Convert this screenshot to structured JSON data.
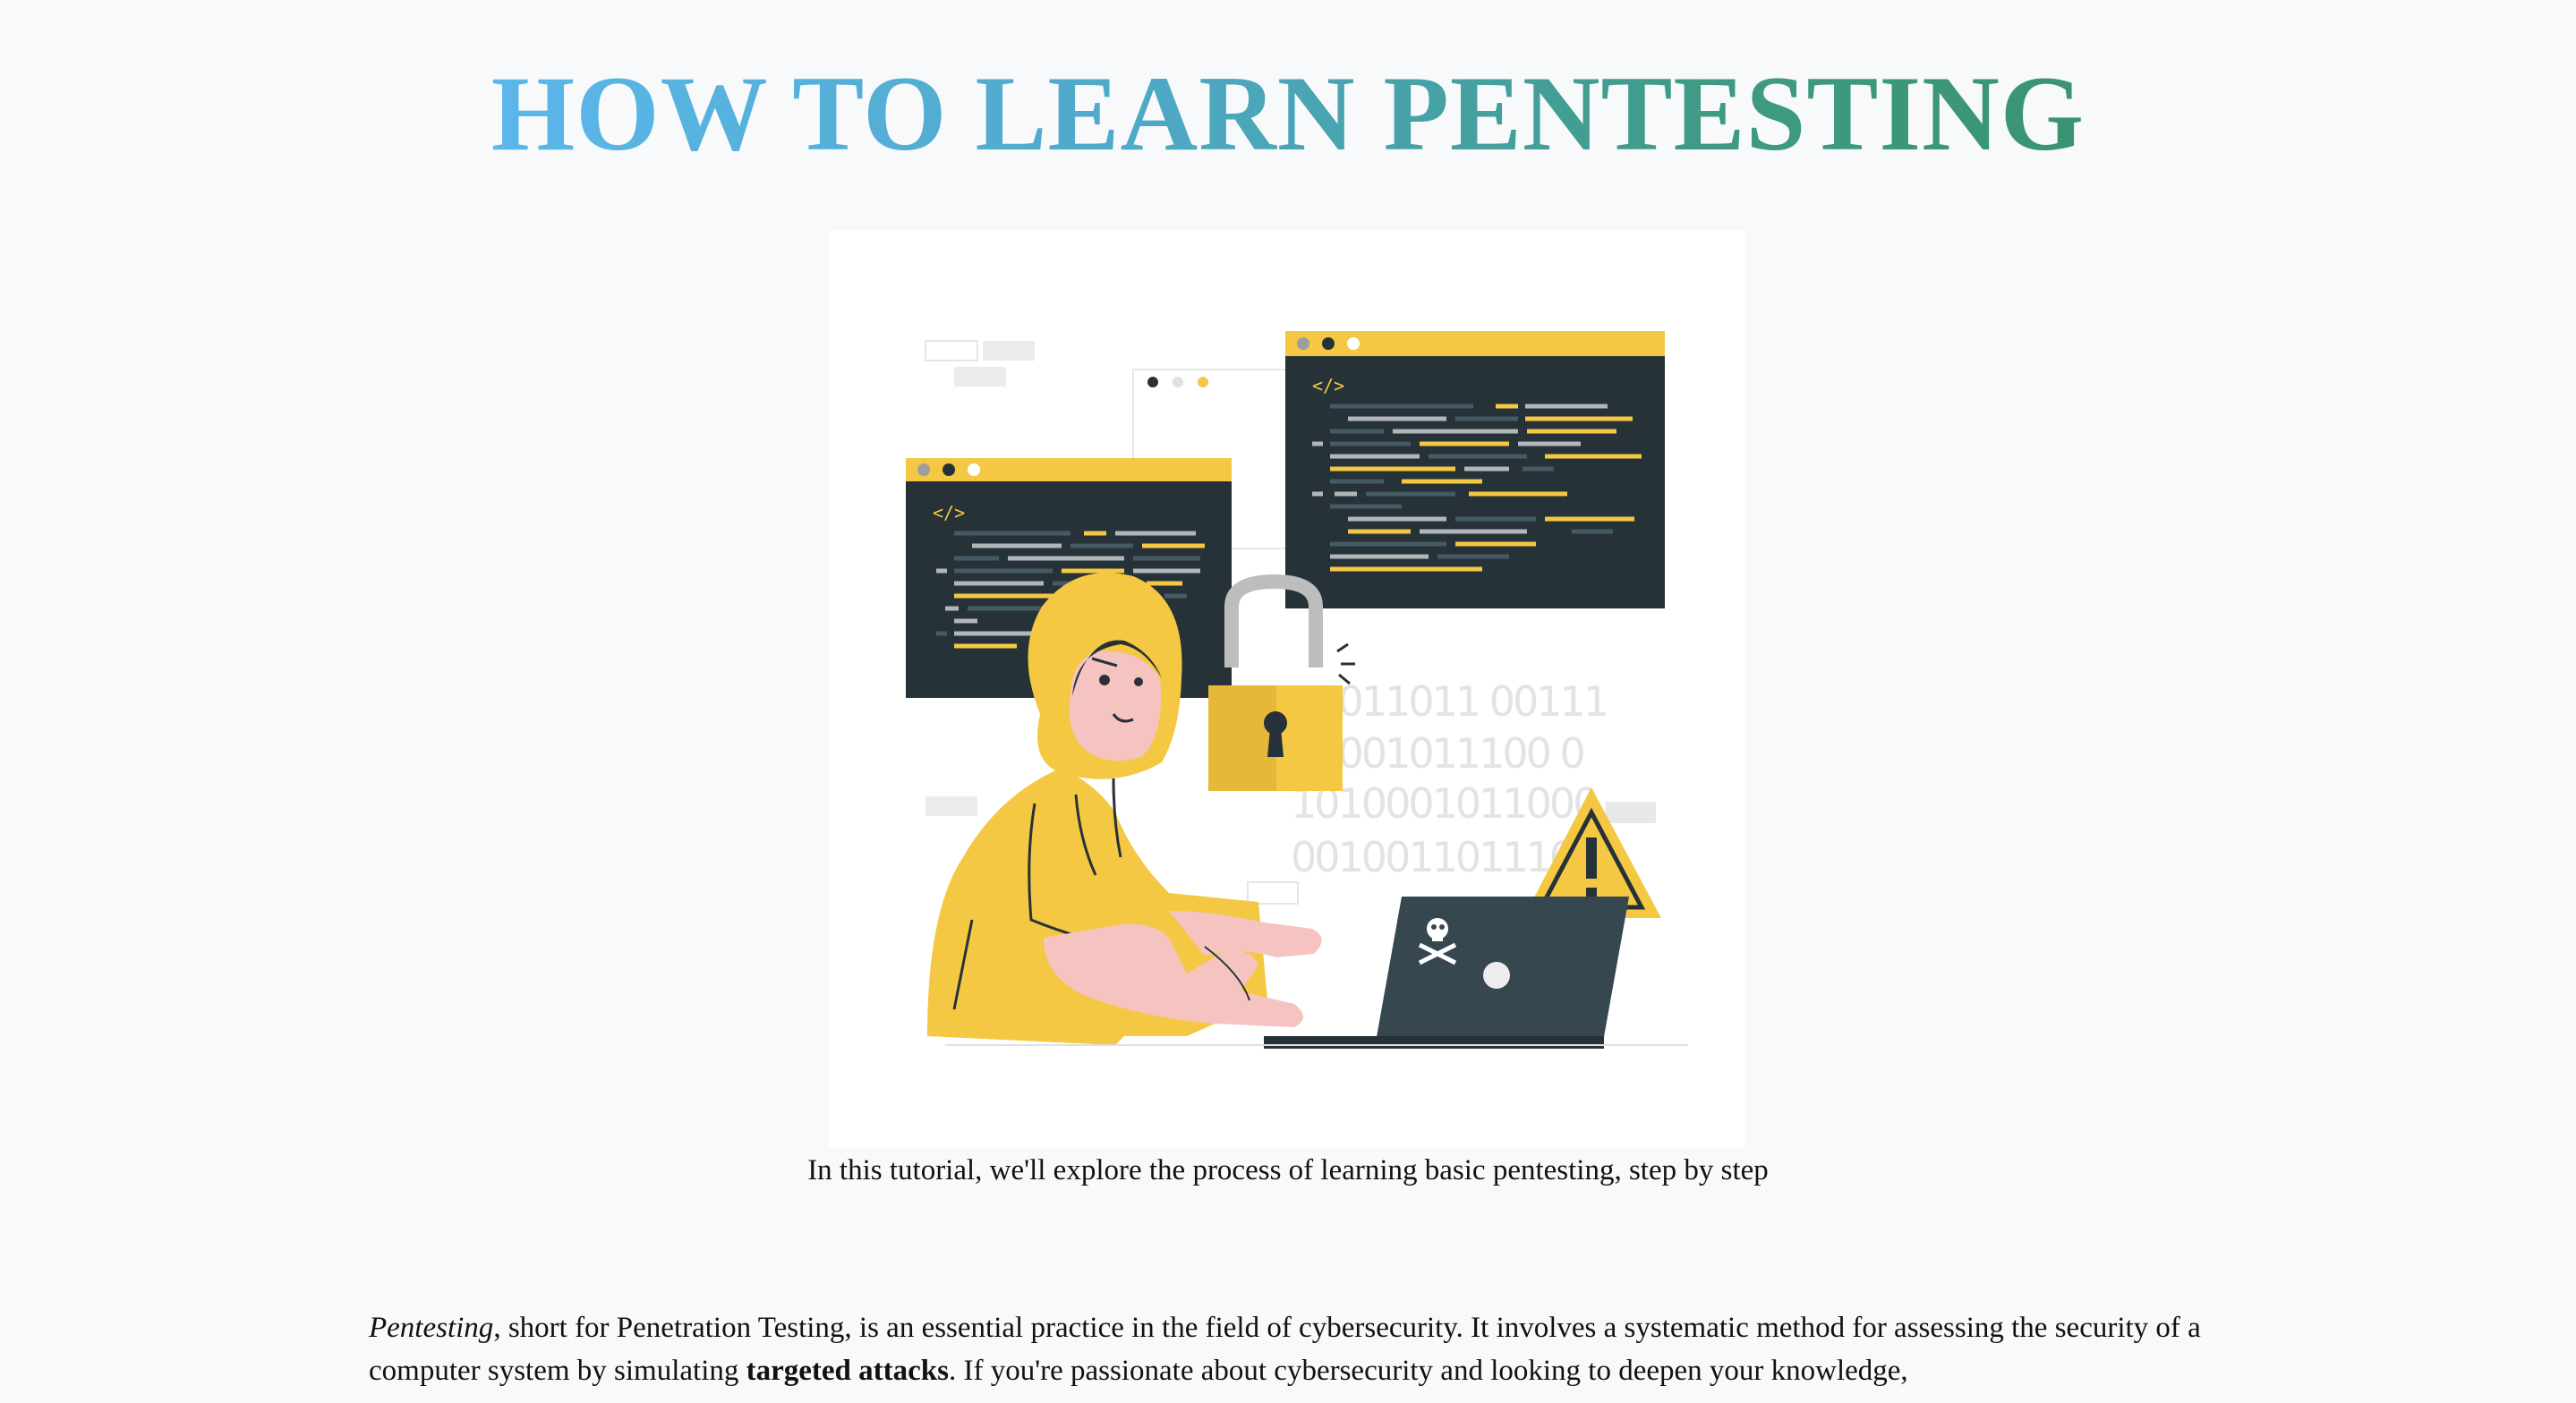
{
  "article": {
    "title": "HOW TO LEARN PENTESTING",
    "hero_image": {
      "icon": "hacker-with-laptop-illustration",
      "binary_rows": [
        "10011011 00111",
        "10001011100 0",
        "1010001011000",
        "00100110111000"
      ],
      "code_tag": "</>"
    },
    "caption": "In this tutorial, we'll explore the process of learning basic pentesting, step by step",
    "intro": {
      "term": "Pentesting",
      "part1": ", short for Penetration Testing, is an essential practice in the field of cybersecurity. It involves a systematic method for assessing the security of a computer system by simulating ",
      "emphasis": "targeted attacks",
      "part2": ". If you're passionate about cybersecurity and looking to deepen your knowledge,"
    }
  },
  "colors": {
    "title_gradient_start": "#5bb7ea",
    "title_gradient_end": "#3a9470",
    "accent_yellow": "#f4c842",
    "dark_panel": "#263238",
    "page_background": "#f8f9fb"
  }
}
